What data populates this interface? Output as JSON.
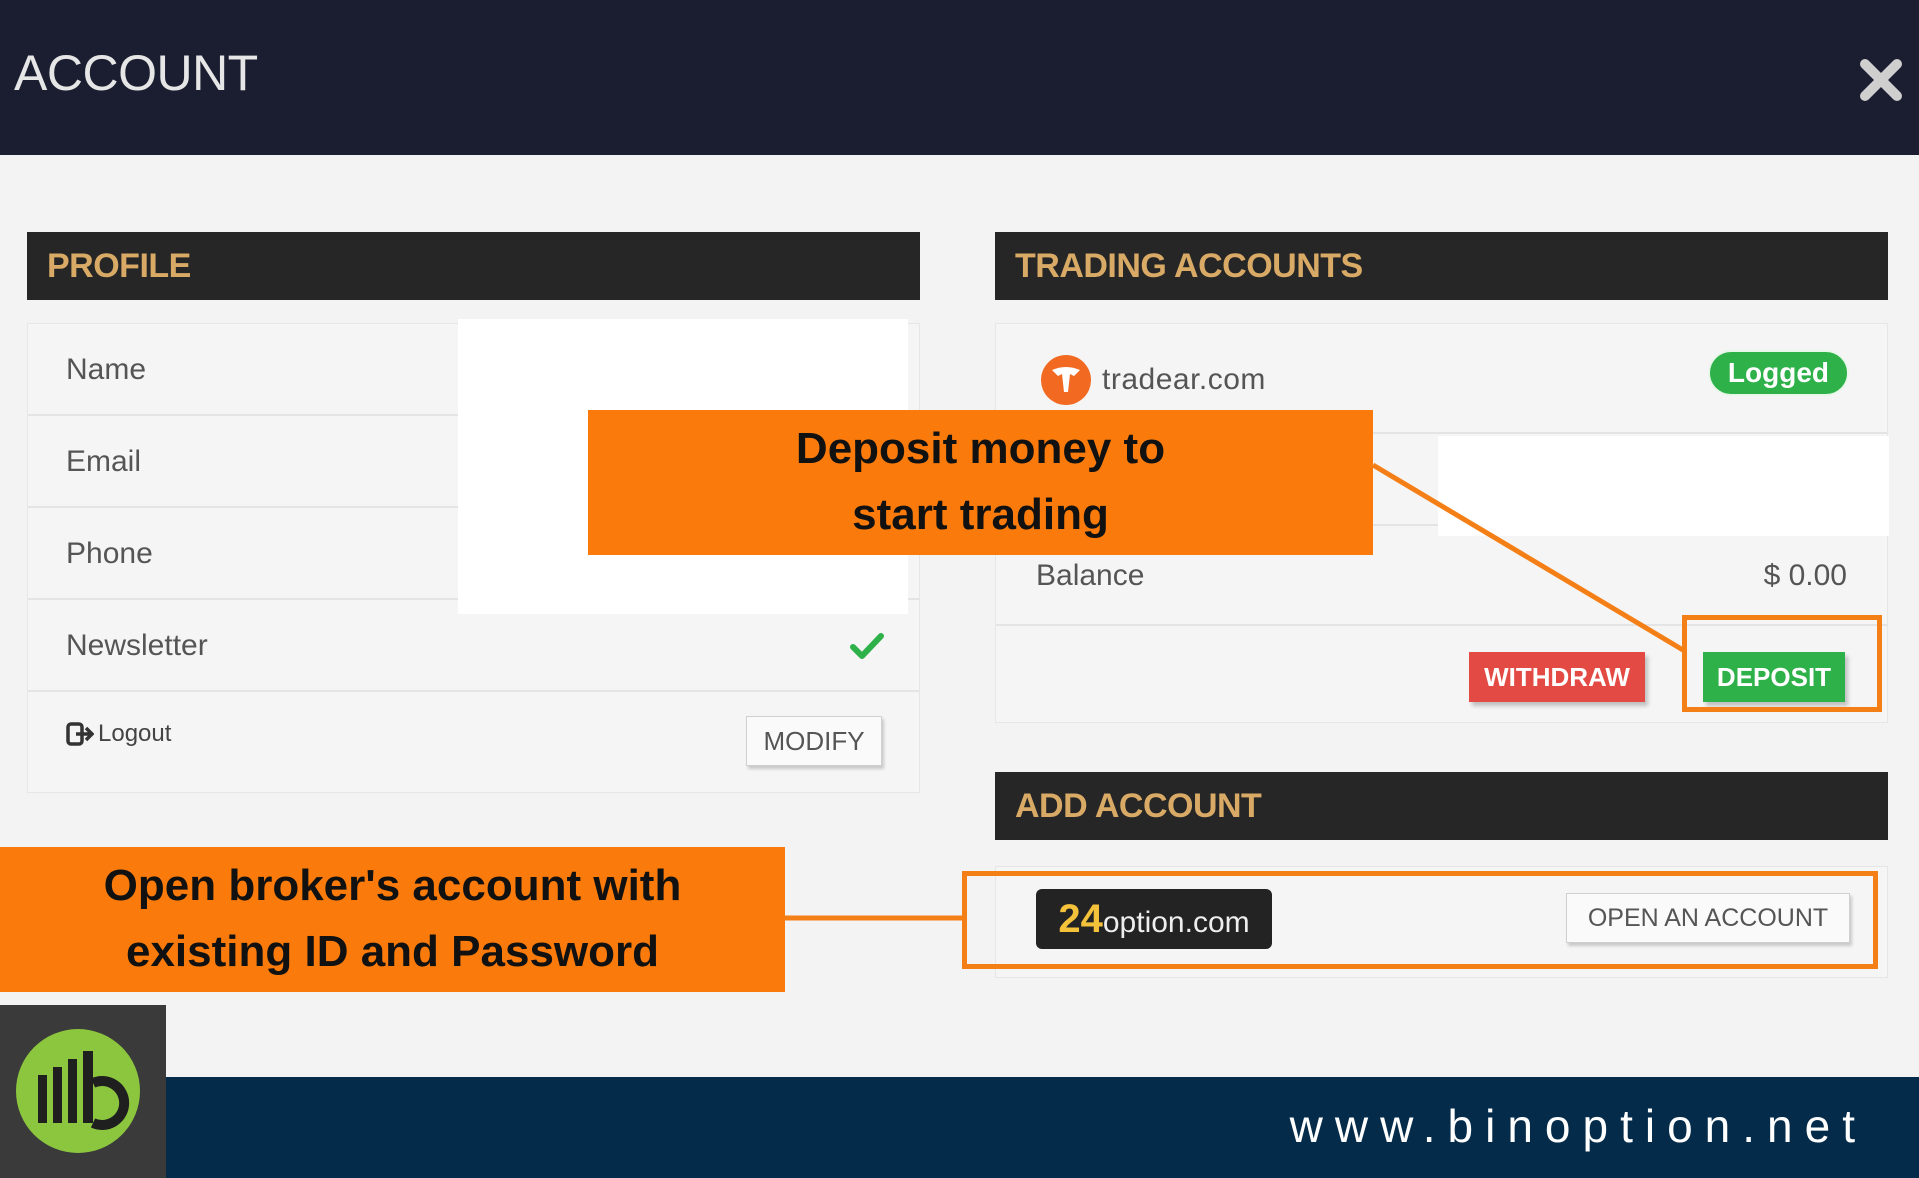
{
  "header": {
    "title": "ACCOUNT",
    "close_icon": "close-icon"
  },
  "profile": {
    "heading": "PROFILE",
    "fields": [
      {
        "label": "Name"
      },
      {
        "label": "Email"
      },
      {
        "label": "Phone"
      },
      {
        "label": "Newsletter",
        "status_icon": "check-icon"
      }
    ],
    "logout_label": "Logout",
    "modify_label": "MODIFY"
  },
  "trading_accounts": {
    "heading": "TRADING ACCOUNTS",
    "broker": "tradear.com",
    "status": "Logged",
    "balance_label": "Balance",
    "balance_value": "$ 0.00",
    "withdraw_label": "WITHDRAW",
    "deposit_label": "DEPOSIT"
  },
  "add_account": {
    "heading": "ADD ACCOUNT",
    "broker_logo_number": "24",
    "broker_logo_text": "option.com",
    "open_label": "OPEN AN ACCOUNT"
  },
  "annotations": {
    "deposit_line1": "Deposit money to",
    "deposit_line2": "start trading",
    "open_line1": "Open broker's account with",
    "open_line2": "existing ID and Password"
  },
  "footer": {
    "url": "www.binoption.net"
  },
  "colors": {
    "header_bg": "#1b1e31",
    "section_header_bg": "#262626",
    "section_header_text": "#d9aa66",
    "callout": "#fa7b0c",
    "deposit": "#2fb14a",
    "withdraw": "#e24a43",
    "footer_bg": "#042b4a",
    "logo_green": "#8cc63e"
  }
}
